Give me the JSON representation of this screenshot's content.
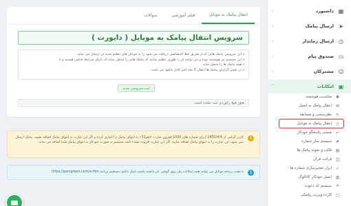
{
  "tabs": [
    {
      "label": "انتقال پیامک به موبایل",
      "active": true
    },
    {
      "label": "فیلم آموزشی",
      "active": false
    },
    {
      "label": "سوالات",
      "active": false
    }
  ],
  "service_title": "سرویس انتقال پیامک به موبایل ( دایورت )",
  "descriptions": [
    "این سرویس پیامک هایی که از طریق خط اختصاصی دریافت می شود را به موبایل های تنظیم شده آن ارسال می نماید.",
    "این سیستم نیز هوشمند بوده و می توانید آن را طوری تنظیم نمایید که پیامک هایی را منتقل نماید که دارای شرایط خاصی هستند و یا",
    "همه پیامک ها را منتقل نماید .",
    "در بخش گزارش پیامک ها انتقال 3 ماه اخیر قابل دانلود می باشد."
  ],
  "register_button": "ثبت سرویس جدید",
  "empty_state": "هنوز هیچ رکوردی ثبت نشده است.",
  "warning_alert": "کاربر گرامی از 1402/4/4 (برای شماره های 1000 فقرون عبارت «لغو11» به انتهای پیامک را اجباری کرده و اگر این عبارت به انتهای پیامک اضافه نشود، پیامک ارسال نمی شود. این عبارت را به انتهای پیامک اضافه نمایید. اگر این عبارت افزوده نشده باشد سیستم به صورت خودکار به انتهای پیامک شما اضافه می نماید.",
  "info_alert": "با نصب برنامه موبایل می توانید همه امکانات پنل روی گوشی تان داشته باشید. لینک دانلود مستقیم برنامه https://parsgreen.com/a.htm",
  "sidebar": {
    "main_items": [
      {
        "label": "داشبورد",
        "icon": "dashboard-icon",
        "glyph": "▦"
      },
      {
        "label": "ارسال پیامک",
        "icon": "send-icon",
        "glyph": "➤"
      },
      {
        "label": "ارسال زماندار",
        "icon": "clock-icon",
        "glyph": "◷"
      },
      {
        "label": "صندوق پیام",
        "icon": "inbox-icon",
        "glyph": "▭"
      },
      {
        "label": "مشترکان",
        "icon": "users-icon",
        "glyph": "☺"
      },
      {
        "label": "امکانات",
        "icon": "features-icon",
        "glyph": "▣"
      }
    ],
    "sub_items": [
      {
        "label": "مناسبت هوشمند",
        "glyph": "✱"
      },
      {
        "label": "انتقال پیامک به ایمیل",
        "glyph": "✉"
      },
      {
        "label": "نظرسنجی و مسابقه",
        "glyph": "✎"
      },
      {
        "label": "انتقال پیامک به موبایل",
        "glyph": "▯"
      },
      {
        "label": "منشی پاسخگو خودکار",
        "glyph": "↩"
      },
      {
        "label": "سیستم ساز شماره",
        "glyph": "#"
      },
      {
        "label": "قالب و نمونه پیامک ها",
        "glyph": "▤"
      },
      {
        "label": "قرائت قرآن",
        "glyph": "◫"
      },
      {
        "label": "ابزار معتبرسازی شماره ها",
        "glyph": "✓"
      },
      {
        "label": "ایمیل خودکار کاتالوگ",
        "glyph": "▥"
      },
      {
        "label": "سیستم کد دعوت",
        "glyph": "⌗"
      },
      {
        "label": "کارت ویزیت پیامکی",
        "glyph": "▢"
      }
    ]
  }
}
